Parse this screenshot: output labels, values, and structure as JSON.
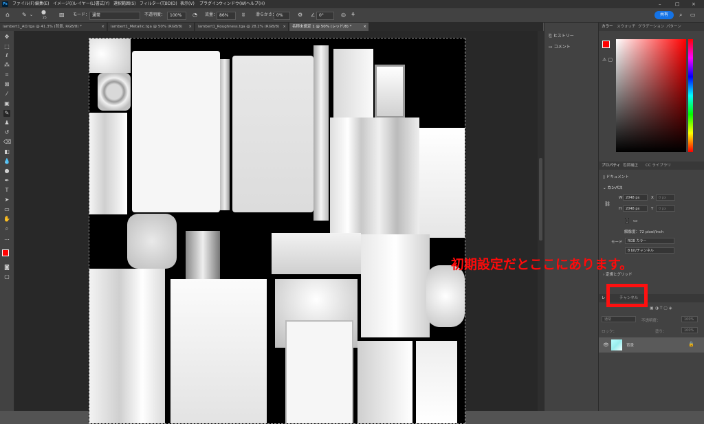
{
  "menubar": {
    "app_icon": "Ps",
    "items": [
      "ファイル(F)",
      "編集(E)",
      "イメージ(I)",
      "レイヤー(L)",
      "書式(Y)",
      "選択範囲(S)",
      "フィルター(T)",
      "3D(D)",
      "表示(V)",
      "プラグイン",
      "ウィンドウ(W)",
      "ヘルプ(H)"
    ],
    "window_controls": [
      "–",
      "□",
      "×"
    ]
  },
  "options": {
    "brush_size": "25",
    "mode_label": "モード：",
    "mode_value": "通常",
    "opacity_label": "不透明度：",
    "opacity_value": "100%",
    "flow_label": "流量：",
    "flow_value": "86%",
    "smoothing_label": "滑らかさ：",
    "smoothing_value": "0%",
    "angle_value": "0°",
    "share_label": "共有"
  },
  "tabs": [
    {
      "label": "lambert1_AO.tga @ 41.3% (背景, RGB/8) *",
      "active": false
    },
    {
      "label": "lambert1_Metallic.tga @ 50% (RGB/8)",
      "active": false
    },
    {
      "label": "lambert1_Roughness.tga @ 28.2% (RGB/8)",
      "active": false
    },
    {
      "label": "名称未設定 1 @ 50% (レッド/8) *",
      "active": true
    }
  ],
  "mid_panel": {
    "history_label": "ヒストリー",
    "comment_label": "コメント"
  },
  "color_panel": {
    "tabs": [
      "カラー",
      "スウォッチ",
      "グラデーション",
      "パターン"
    ],
    "foreground": "#ff0000",
    "background": "#ffffff"
  },
  "properties_panel": {
    "tabs": [
      "プロパティ",
      "色調補正",
      "CC ライブラリ"
    ],
    "doc_label": "ドキュメント",
    "section_canvas": "カンバス",
    "w_label": "W",
    "w_value": "2048 px",
    "h_label": "H",
    "h_value": "2048 px",
    "x_label": "X",
    "x_placeholder": "0 px",
    "y_label": "Y",
    "y_placeholder": "0 px",
    "resolution": "解像度：72 pixel/inch",
    "mode_label": "モード",
    "mode_value": "RGB カラー",
    "depth_value": "8 bit/チャンネル",
    "rulers_grids": "定規とグリッド"
  },
  "layers_panel": {
    "tabs": [
      "レ",
      "チャンネル"
    ],
    "blend_mode": "通常",
    "opacity_label": "不透明度：",
    "opacity_value": "100%",
    "lock_label": "ロック：",
    "fill_label": "塗り：",
    "fill_value": "100%",
    "layer_name": "背景"
  },
  "annotation": {
    "text": "初期設定だとここにあります。",
    "color": "#ff0a0a"
  },
  "accent_color": "#1473e6"
}
